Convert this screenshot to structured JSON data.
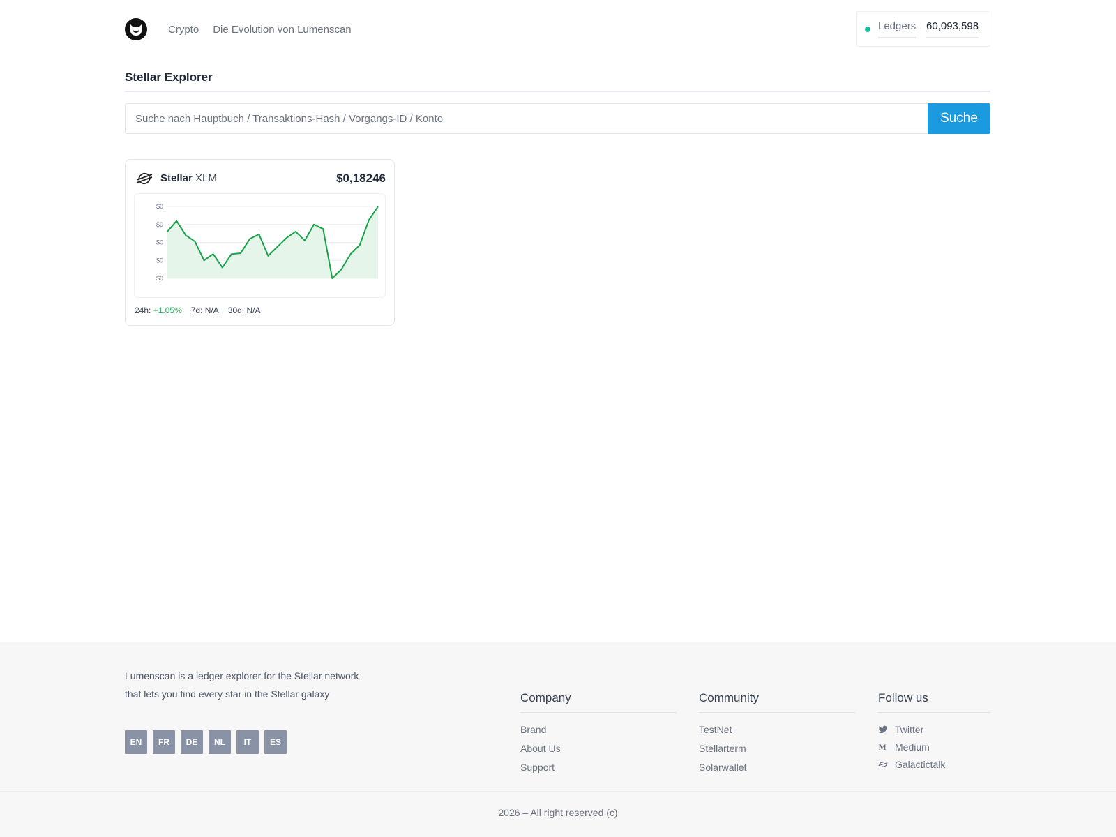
{
  "header": {
    "nav": [
      "Crypto",
      "Die Evolution von Lumenscan"
    ],
    "ledger_label": "Ledgers",
    "ledger_value": "60,093,598"
  },
  "page_title": "Stellar Explorer",
  "search": {
    "placeholder": "Suche nach Hauptbuch / Transaktions-Hash / Vorgangs-ID / Konto",
    "button": "Suche"
  },
  "coin": {
    "name": "Stellar",
    "symbol": "XLM",
    "price": "$0,18246",
    "stats": {
      "h24_label": "24h:",
      "h24_value": "+1.05%",
      "d7": "7d: N/A",
      "d30": "30d: N/A"
    },
    "chart_data": {
      "type": "area",
      "y_tick_labels": [
        "$0",
        "$0",
        "$0",
        "$0",
        "$0"
      ],
      "ylim": [
        0,
        4
      ],
      "values": [
        2.6,
        3.2,
        2.4,
        2.05,
        1.0,
        1.35,
        0.6,
        1.35,
        1.4,
        2.2,
        2.45,
        1.25,
        1.75,
        2.25,
        2.6,
        2.1,
        3.0,
        2.75,
        0.0,
        0.5,
        1.35,
        1.85,
        3.25,
        4.0
      ],
      "color": "#16a34a",
      "fill": "#e6f5ea"
    }
  },
  "footer": {
    "about": "Lumenscan is a ledger explorer for the Stellar network that lets you find every star in the Stellar galaxy",
    "langs": [
      "EN",
      "FR",
      "DE",
      "NL",
      "IT",
      "ES"
    ],
    "company": {
      "title": "Company",
      "links": [
        "Brand",
        "About Us",
        "Support"
      ]
    },
    "community": {
      "title": "Community",
      "links": [
        "TestNet",
        "Stellarterm",
        "Solarwallet"
      ]
    },
    "follow": {
      "title": "Follow us",
      "links": [
        "Twitter",
        "Medium",
        "Galactictalk"
      ]
    },
    "copyright": "2026 – All right reserved (c)"
  }
}
